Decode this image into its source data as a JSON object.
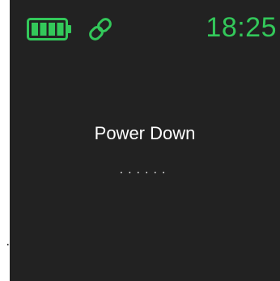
{
  "status_bar": {
    "battery": {
      "icon": "battery-full-icon",
      "color": "#33c85a",
      "level": 1.0,
      "bars": 4
    },
    "link": {
      "icon": "link-icon",
      "color": "#33c85a"
    },
    "time": "18:25"
  },
  "main": {
    "message": "Power Down",
    "progress_indicator": "......"
  },
  "edge_mark": ".",
  "colors": {
    "screen_background": "#222222",
    "accent": "#33c85a",
    "text": "#ffffff"
  }
}
